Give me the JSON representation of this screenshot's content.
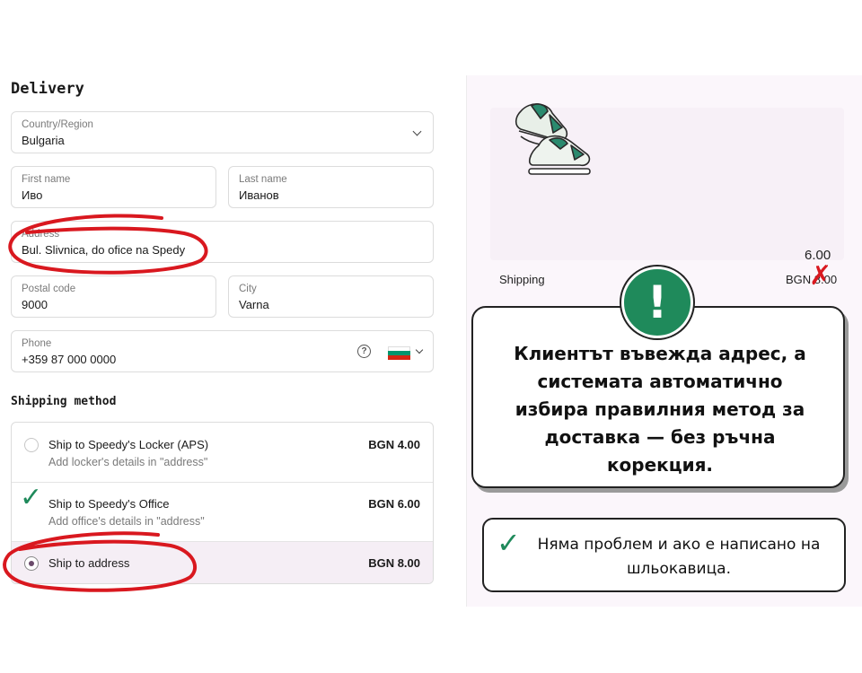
{
  "delivery": {
    "heading": "Delivery",
    "country": {
      "label": "Country/Region",
      "value": "Bulgaria"
    },
    "first_name": {
      "label": "First name",
      "value": "Иво"
    },
    "last_name": {
      "label": "Last name",
      "value": "Иванов"
    },
    "address": {
      "label": "Address",
      "value": "Bul. Slivnica, do ofice na Spedy"
    },
    "postal_code": {
      "label": "Postal code",
      "value": "9000"
    },
    "city": {
      "label": "City",
      "value": "Varna"
    },
    "phone": {
      "label": "Phone",
      "value": "+359 87 000 0000",
      "help": "?"
    }
  },
  "shipping": {
    "heading": "Shipping method",
    "options": [
      {
        "title": "Ship to Speedy's Locker (APS)",
        "subtitle": "Add locker's details in \"address\"",
        "price": "BGN 4.00",
        "selected": false
      },
      {
        "title": "Ship to Speedy's Office",
        "subtitle": "Add office's details in \"address\"",
        "price": "BGN 6.00",
        "selected": false
      },
      {
        "title": "Ship to address",
        "subtitle": "",
        "price": "BGN 8.00",
        "selected": true
      }
    ]
  },
  "summary": {
    "corrected_price": "6.00",
    "shipping_label": "Shipping",
    "shipping_old_price": "BGN 8.00"
  },
  "callout": {
    "mark": "!",
    "text": "Клиентът въвежда адрес, а системата автоматично избира правилния метод за доставка — без ръчна корекция."
  },
  "note": {
    "check": "✓",
    "text": "Няма проблем и ако е написано на шльокавица."
  },
  "icons": {
    "check": "✓",
    "cross": "✗",
    "country_flag": "bulgaria-flag-icon",
    "product": "sneakers-icon"
  },
  "colors": {
    "accent_green": "#1f8a5b",
    "annotation_red": "#d9181f",
    "selected_row_bg": "#f5eef5"
  }
}
